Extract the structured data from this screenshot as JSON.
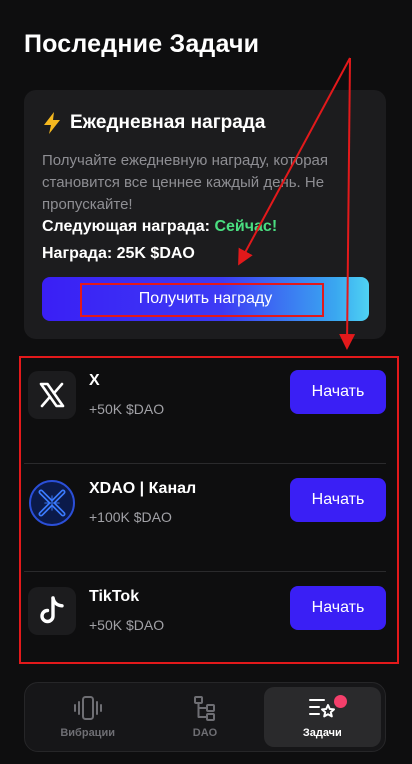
{
  "page": {
    "title": "Последние Задачи"
  },
  "daily": {
    "title": "Ежедневная награда",
    "description": "Получайте ежедневную награду, которая становится все ценнее каждый день. Не пропускайте!",
    "next_label": "Следующая награда:",
    "next_value": "Сейчас!",
    "reward_label": "Награда:",
    "reward_value": "25K $DAO",
    "button_label": "Получить награду"
  },
  "tasks": [
    {
      "name": "X",
      "reward": "+50K $DAO",
      "button": "Начать",
      "icon": "x-logo-icon"
    },
    {
      "name": "XDAO | Канал",
      "reward": "+100K $DAO",
      "button": "Начать",
      "icon": "xdao-logo-icon"
    },
    {
      "name": "TikTok",
      "reward": "+50K $DAO",
      "button": "Начать",
      "icon": "tiktok-logo-icon"
    }
  ],
  "nav": {
    "tabs": [
      {
        "label": "Вибрации",
        "icon": "vibration-icon"
      },
      {
        "label": "DAO",
        "icon": "tree-icon"
      },
      {
        "label": "Задачи",
        "icon": "tasks-star-icon",
        "active": true
      }
    ]
  },
  "colors": {
    "accent": "#3a1ff5",
    "success": "#4ade80",
    "annotation": "#e3191b",
    "badge": "#f43f6b"
  }
}
